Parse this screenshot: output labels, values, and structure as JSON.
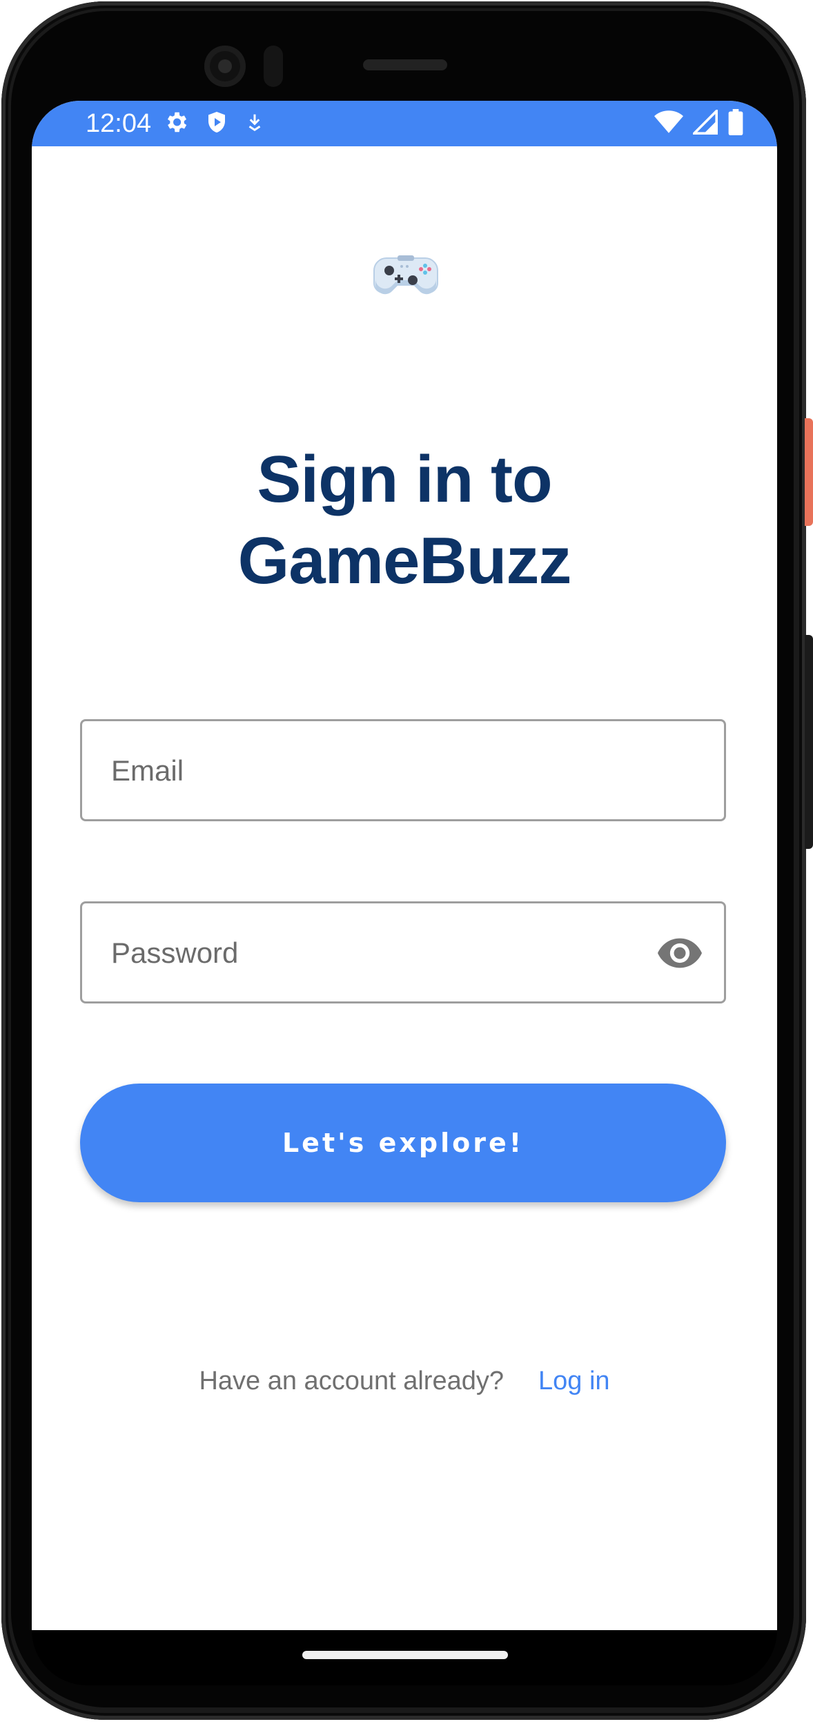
{
  "status_bar": {
    "time": "12:04",
    "color": "#4285f4",
    "left_icons": [
      "gear-icon",
      "shield-play-icon",
      "download-icon"
    ],
    "right_icons": [
      "wifi-icon",
      "signal-icon",
      "battery-icon"
    ]
  },
  "app": {
    "logo_icon": "game-controller-icon",
    "title_line1": "Sign in to",
    "title_line2": "GameBuzz",
    "title_color": "#0d3366"
  },
  "form": {
    "email": {
      "placeholder": "Email",
      "value": ""
    },
    "password": {
      "placeholder": "Password",
      "value": "",
      "toggle_icon": "eye-icon"
    },
    "submit_label": "Let's explore!",
    "accent_color": "#4285f4"
  },
  "footer": {
    "prompt": "Have an account already?",
    "link_label": "Log in"
  }
}
